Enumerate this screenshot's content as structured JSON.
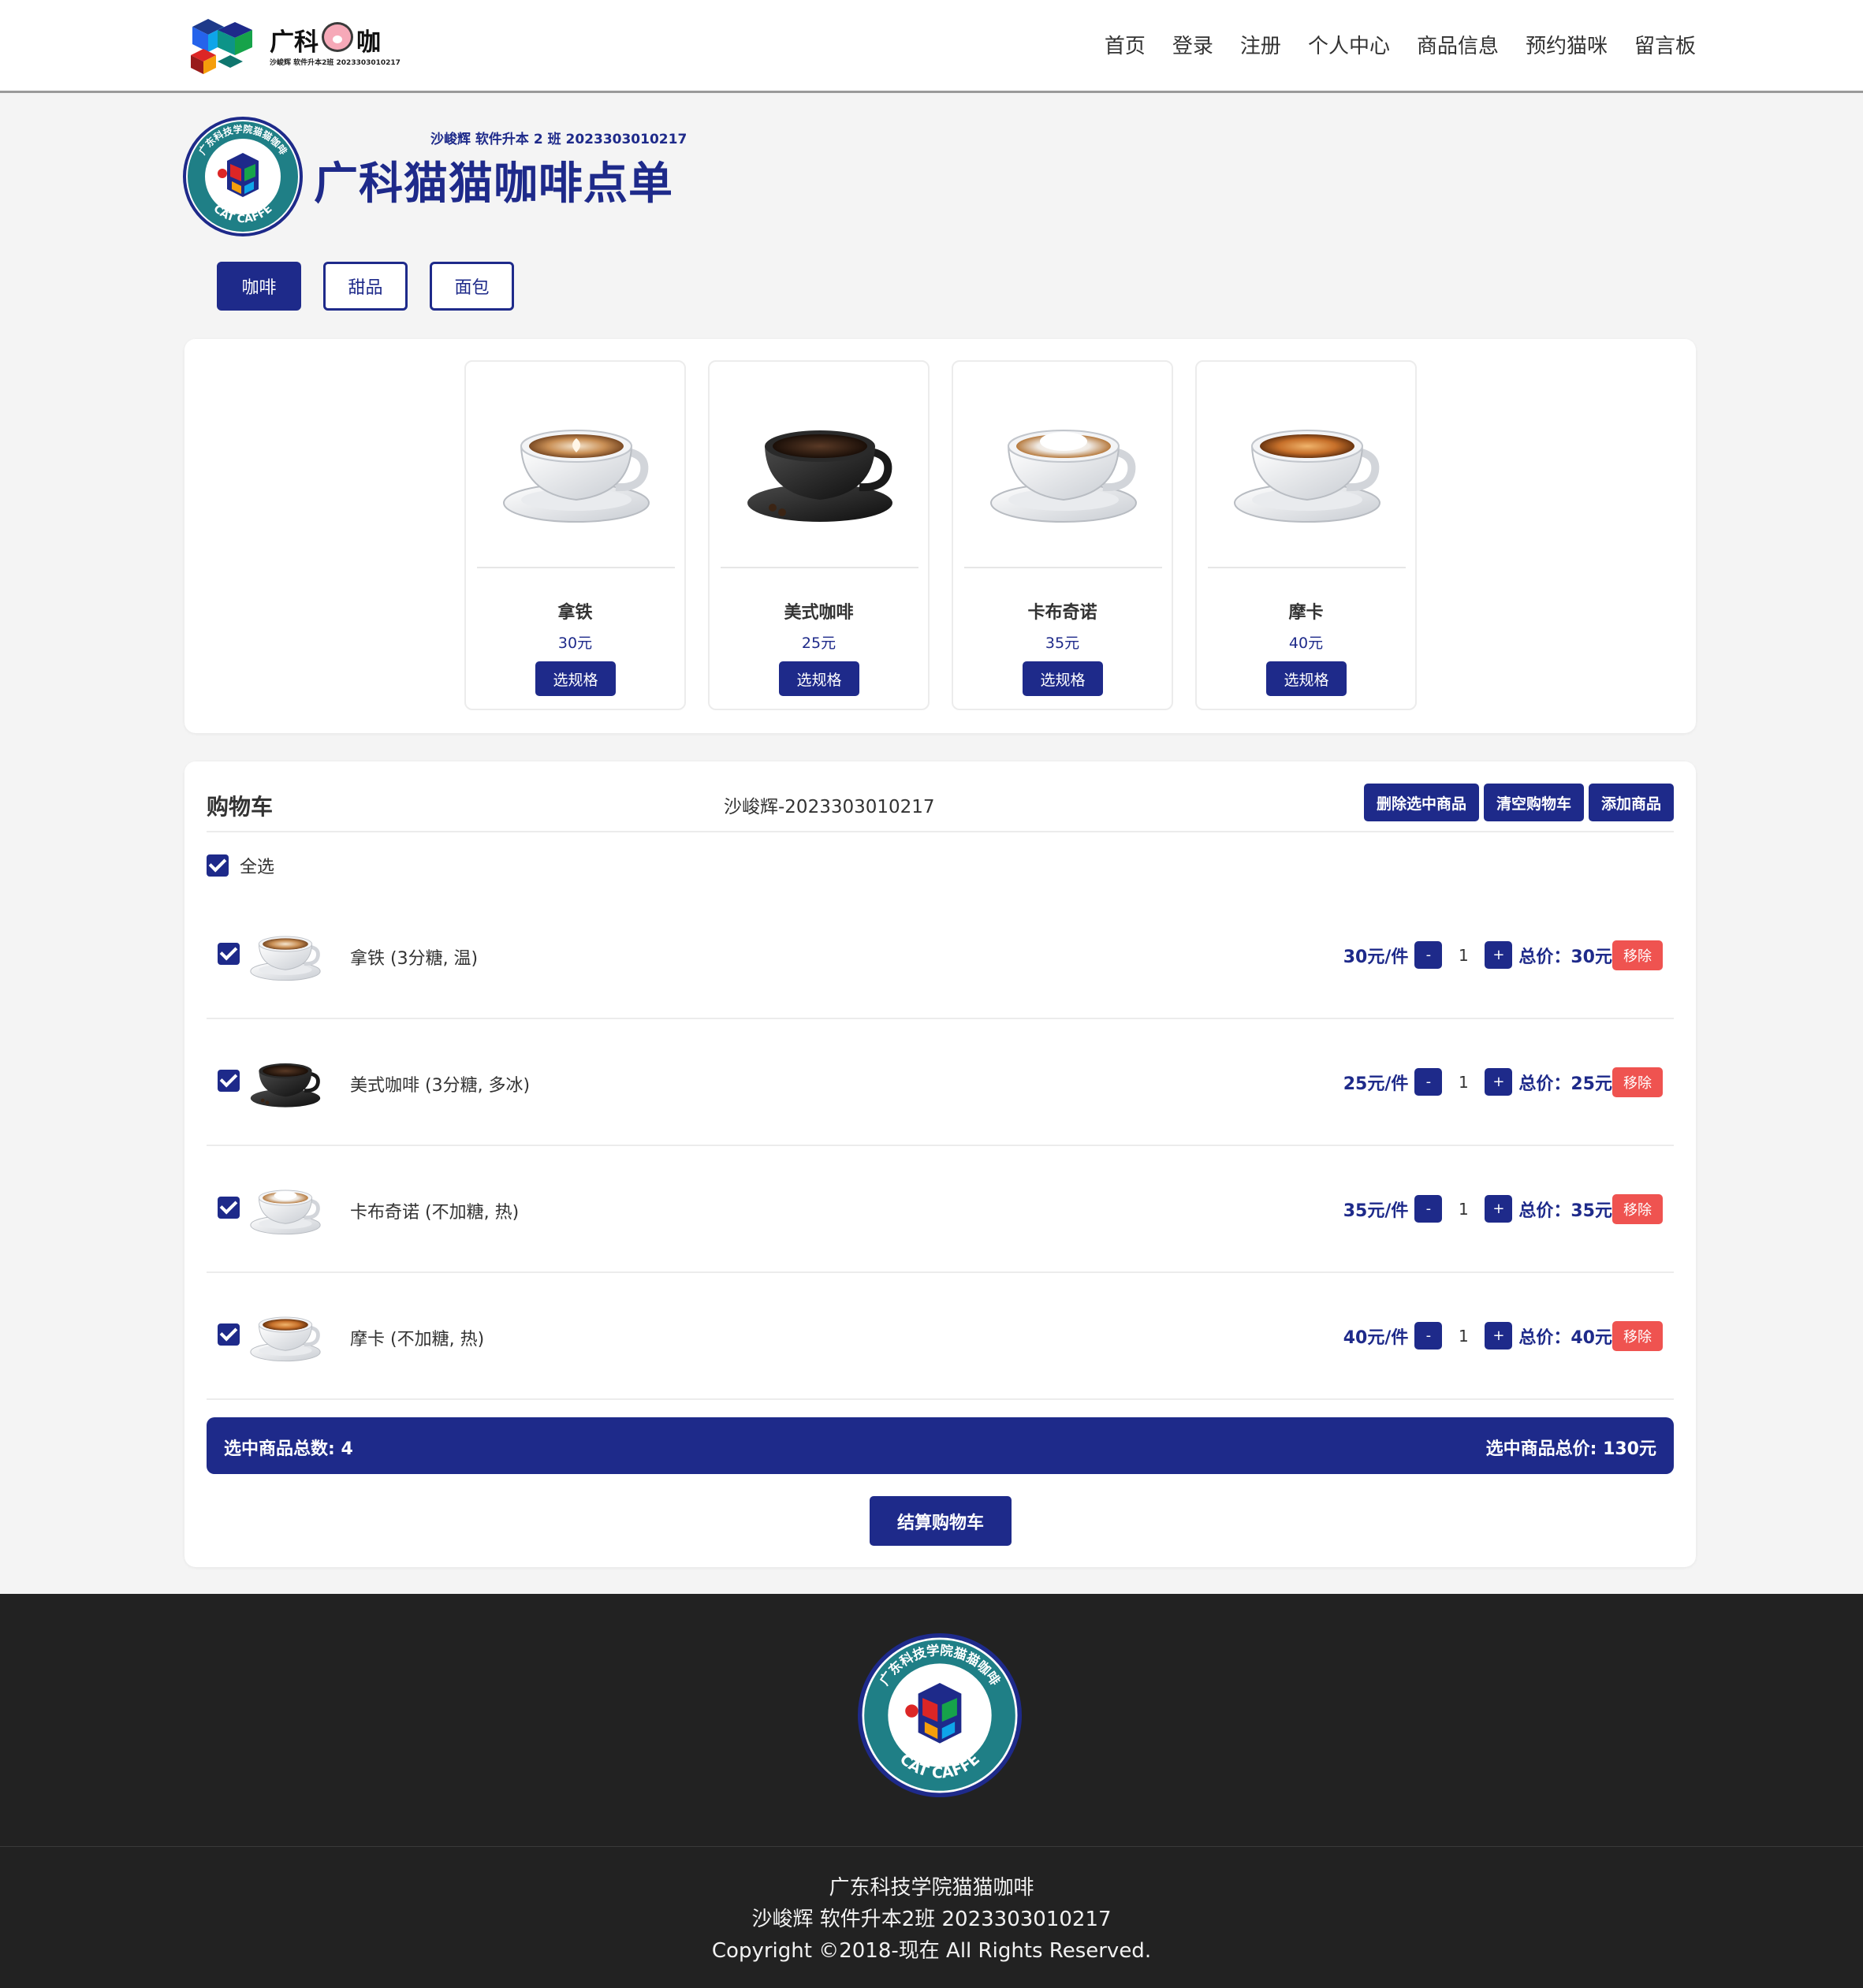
{
  "nav": {
    "brand_name": "广科",
    "brand_name2": "咖",
    "brand_sub": "沙峻辉 软件升本2班 2023303010217",
    "links": [
      "首页",
      "登录",
      "注册",
      "个人中心",
      "商品信息",
      "预约猫咪",
      "留言板"
    ]
  },
  "header": {
    "badge_top_text": "广东科技学院猫猫咖啡",
    "badge_bottom_text": "CAT CAFFE",
    "subtitle": "沙峻辉 软件升本 2 班 2023303010217",
    "title": "广科猫猫咖啡点单"
  },
  "categories": [
    {
      "label": "咖啡",
      "active": true
    },
    {
      "label": "甜品",
      "active": false
    },
    {
      "label": "面包",
      "active": false
    }
  ],
  "products": [
    {
      "name": "拿铁",
      "price": "30元",
      "button": "选规格",
      "icon": "latte-cup-icon"
    },
    {
      "name": "美式咖啡",
      "price": "25元",
      "button": "选规格",
      "icon": "americano-cup-icon"
    },
    {
      "name": "卡布奇诺",
      "price": "35元",
      "button": "选规格",
      "icon": "cappuccino-cup-icon"
    },
    {
      "name": "摩卡",
      "price": "40元",
      "button": "选规格",
      "icon": "mocha-cup-icon"
    }
  ],
  "cart": {
    "title": "购物车",
    "owner": "沙峻辉-2023303010217",
    "actions": [
      "删除选中商品",
      "清空购物车",
      "添加商品"
    ],
    "select_all_label": "全选",
    "items": [
      {
        "name": "拿铁 (3分糖, 温)",
        "unit_price": "30元/件",
        "qty": "1",
        "total": "总价：30元",
        "remove": "移除",
        "minus": "-",
        "plus": "+",
        "checked": true
      },
      {
        "name": "美式咖啡 (3分糖, 多冰)",
        "unit_price": "25元/件",
        "qty": "1",
        "total": "总价：25元",
        "remove": "移除",
        "minus": "-",
        "plus": "+",
        "checked": true
      },
      {
        "name": "卡布奇诺 (不加糖, 热)",
        "unit_price": "35元/件",
        "qty": "1",
        "total": "总价：35元",
        "remove": "移除",
        "minus": "-",
        "plus": "+",
        "checked": true
      },
      {
        "name": "摩卡 (不加糖, 热)",
        "unit_price": "40元/件",
        "qty": "1",
        "total": "总价：40元",
        "remove": "移除",
        "minus": "-",
        "plus": "+",
        "checked": true
      }
    ],
    "summary_count": "选中商品总数: 4",
    "summary_total": "选中商品总价: 130元",
    "checkout": "结算购物车"
  },
  "footer": {
    "line1": "广东科技学院猫猫咖啡",
    "line2": "沙峻辉 软件升本2班 2023303010217",
    "line3": "Copyright ©2018-现在 All Rights Reserved."
  },
  "colors": {
    "accent": "#1e2a8a",
    "danger": "#ef5350",
    "footer_bg": "#222222",
    "page_bg": "#f4f4f4"
  }
}
